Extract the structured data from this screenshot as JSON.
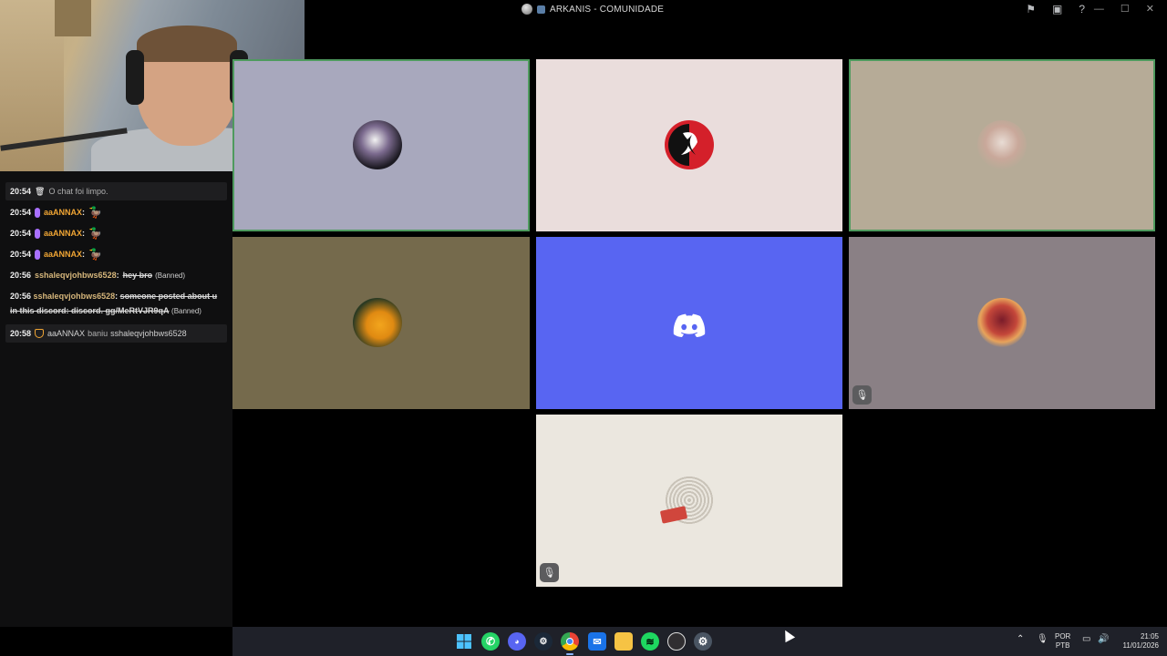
{
  "window": {
    "title": "ARKANIS - COMUNIDADE",
    "toolbar_icons": [
      "flag-icon",
      "inbox-icon",
      "help-icon"
    ],
    "controls": [
      "minimize",
      "maximize",
      "close"
    ]
  },
  "chat": {
    "messages": [
      {
        "type": "system",
        "time": "20:54",
        "icon": "trash-icon",
        "text": "O chat foi limpo."
      },
      {
        "type": "message",
        "time": "20:54",
        "badge": "vip-badge",
        "user": "aaANNAX",
        "emote": "duck-emote"
      },
      {
        "type": "message",
        "time": "20:54",
        "badge": "vip-badge",
        "user": "aaANNAX",
        "emote": "duck-emote"
      },
      {
        "type": "message",
        "time": "20:54",
        "badge": "vip-badge",
        "user": "aaANNAX",
        "emote": "duck-emote"
      },
      {
        "type": "deleted",
        "time": "20:56",
        "user": "sshaleqvjohbws6528",
        "text": "hey bro",
        "tag": "(Banned)"
      },
      {
        "type": "deleted",
        "time": "20:56",
        "user": "sshaleqvjohbws6528",
        "text": "someone posted about u in this discord: discord. gg/MeRtVJR9qA",
        "tag": "(Banned)"
      },
      {
        "type": "system",
        "time": "20:58",
        "icon": "shield-icon",
        "actor": "aaANNAX",
        "verb": "baniu",
        "target": "sshaleqvjohbws6528"
      }
    ]
  },
  "call": {
    "tiles": [
      {
        "id": "user-1",
        "bg": "#a8a8bd",
        "speaking": true,
        "muted": false,
        "avatar": "cartoon-character-avatar"
      },
      {
        "id": "user-2",
        "bg": "#eadddc",
        "speaking": false,
        "muted": false,
        "avatar": "scorpion-logo-avatar"
      },
      {
        "id": "user-3",
        "bg": "#b6ab97",
        "speaking": true,
        "muted": false,
        "avatar": "cowboy-hat-avatar"
      },
      {
        "id": "user-4",
        "bg": "#756a4c",
        "speaking": false,
        "muted": false,
        "avatar": "duck-avatar"
      },
      {
        "id": "user-5",
        "bg": "#5865f2",
        "speaking": false,
        "muted": false,
        "avatar": "discord-logo-avatar"
      },
      {
        "id": "user-6",
        "bg": "#8a8085",
        "speaking": false,
        "muted": true,
        "avatar": "pixel-character-avatar"
      },
      {
        "id": "user-7",
        "bg": "#ebe7df",
        "speaking": false,
        "muted": true,
        "avatar": "sticker-avatar"
      }
    ]
  },
  "taskbar": {
    "apps": [
      "windows-start-icon",
      "whatsapp-icon",
      "discord-icon",
      "steam-icon",
      "chrome-icon",
      "mail-icon",
      "file-explorer-icon",
      "spotify-icon",
      "obs-icon",
      "settings-icon"
    ],
    "language_top": "POR",
    "language_bottom": "PTB",
    "time": "21:05",
    "date": "11/01/2026"
  }
}
